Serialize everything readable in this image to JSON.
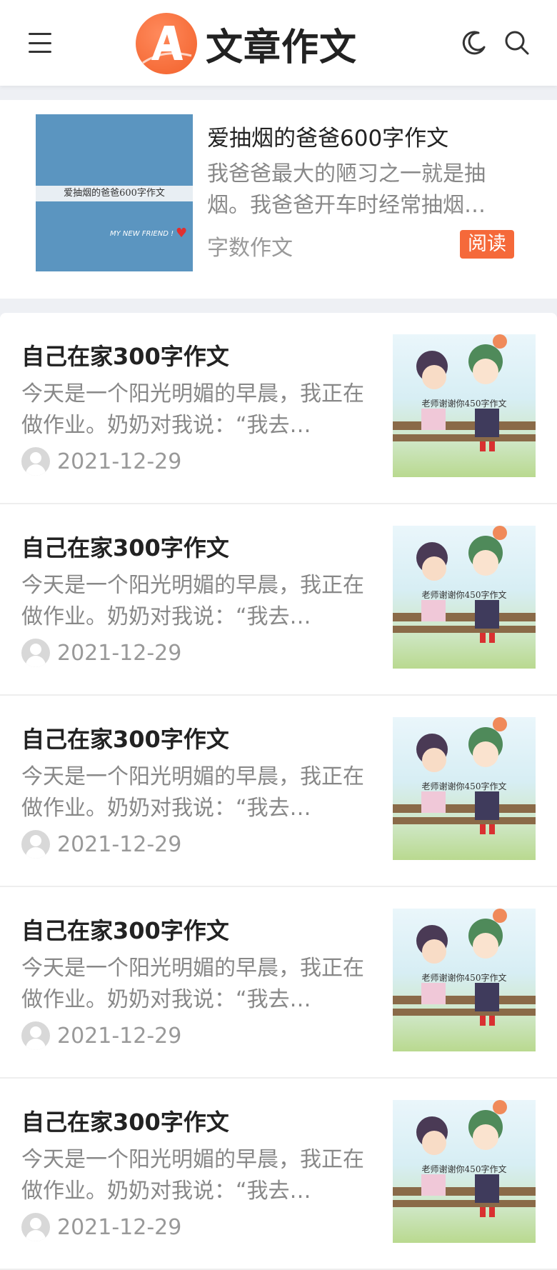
{
  "header": {
    "logo_text": "文章作文",
    "icons": [
      "menu-icon",
      "moon-icon",
      "search-icon"
    ]
  },
  "featured": {
    "title": "爱抽烟的爸爸600字作文",
    "excerpt": "我爸爸最大的陋习之一就是抽烟。我爸爸开车时经常抽烟…",
    "category": "字数作文",
    "read_label": "阅读",
    "thumb_caption": "爱抽烟的爸爸600字作文",
    "thumb_tagline": "MY NEW FRIEND !"
  },
  "list": {
    "items": [
      {
        "title": "自己在家300字作文",
        "excerpt": "今天是一个阳光明媚的早晨，我正在做作业。奶奶对我说：“我去…",
        "date": "2021-12-29",
        "thumb_caption": "老师谢谢你450字作文"
      },
      {
        "title": "自己在家300字作文",
        "excerpt": "今天是一个阳光明媚的早晨，我正在做作业。奶奶对我说：“我去…",
        "date": "2021-12-29",
        "thumb_caption": "老师谢谢你450字作文"
      },
      {
        "title": "自己在家300字作文",
        "excerpt": "今天是一个阳光明媚的早晨，我正在做作业。奶奶对我说：“我去…",
        "date": "2021-12-29",
        "thumb_caption": "老师谢谢你450字作文"
      },
      {
        "title": "自己在家300字作文",
        "excerpt": "今天是一个阳光明媚的早晨，我正在做作业。奶奶对我说：“我去…",
        "date": "2021-12-29",
        "thumb_caption": "老师谢谢你450字作文"
      },
      {
        "title": "自己在家300字作文",
        "excerpt": "今天是一个阳光明媚的早晨，我正在做作业。奶奶对我说：“我去…",
        "date": "2021-12-29",
        "thumb_caption": "老师谢谢你450字作文"
      }
    ]
  },
  "colors": {
    "accent": "#f5693a",
    "background": "#eef0f4",
    "text_primary": "#222222",
    "text_secondary": "#888888"
  }
}
